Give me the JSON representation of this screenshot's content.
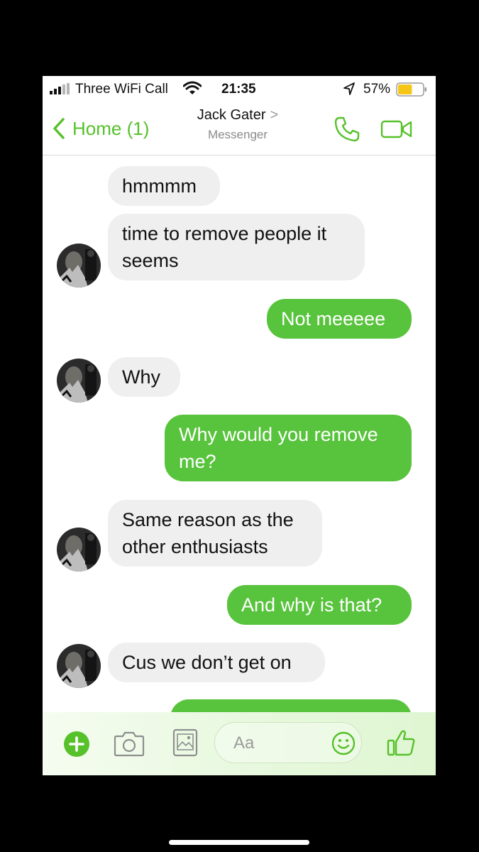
{
  "status_bar": {
    "carrier": "Three WiFi Call",
    "time": "21:35",
    "battery": "57%",
    "battery_level": 0.57,
    "icons": [
      "signal-icon",
      "wifi-icon",
      "location-arrow-icon",
      "battery-icon"
    ]
  },
  "nav": {
    "back_label": "Home (1)",
    "contact_name": "Jack Gater",
    "contact_chevron": ">",
    "contact_subtitle": "Messenger",
    "icons": [
      "chevron-left-icon",
      "phone-icon",
      "video-camera-icon"
    ]
  },
  "messages": [
    {
      "sender": "contact",
      "text": "hmmmm"
    },
    {
      "sender": "contact",
      "text": "time to remove people it seems"
    },
    {
      "sender": "me",
      "text": "Not meeeee"
    },
    {
      "sender": "contact",
      "text": "Why"
    },
    {
      "sender": "me",
      "text": "Why would you remove me?"
    },
    {
      "sender": "contact",
      "text": "Same reason as the other enthusiasts"
    },
    {
      "sender": "me",
      "text": "And why is that?"
    },
    {
      "sender": "contact",
      "text": "Cus we don’t get on"
    }
  ],
  "composer": {
    "placeholder": "Aa",
    "icons": [
      "plus-icon",
      "camera-icon",
      "image-icon",
      "emoji-icon",
      "thumbs-up-icon"
    ]
  },
  "colors": {
    "accent": "#56c12a",
    "outgoing_bubble": "#58c33c",
    "incoming_bubble": "#efefef",
    "battery_fill": "#f5c518"
  }
}
